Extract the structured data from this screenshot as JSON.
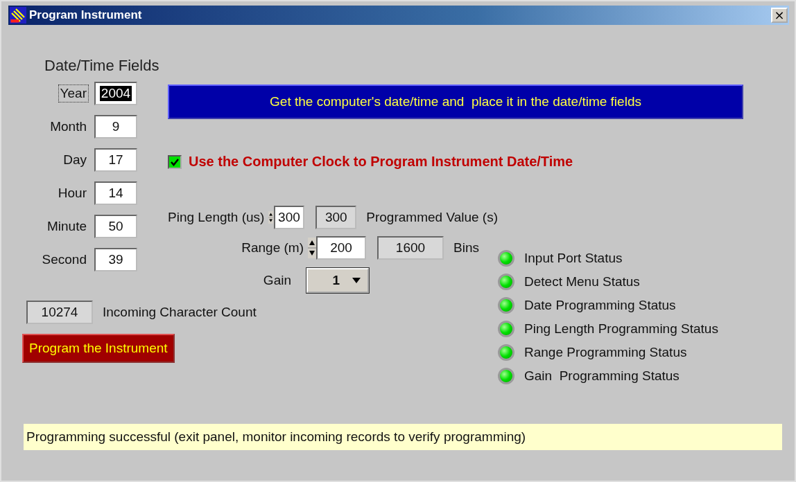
{
  "window": {
    "title": "Program Instrument",
    "close": "×"
  },
  "date_time": {
    "heading": "Date/Time Fields",
    "fields": [
      {
        "label": "Year",
        "value": "2004",
        "focused": true
      },
      {
        "label": "Month",
        "value": "9",
        "focused": false
      },
      {
        "label": "Day",
        "value": "17",
        "focused": false
      },
      {
        "label": "Hour",
        "value": "14",
        "focused": false
      },
      {
        "label": "Minute",
        "value": "50",
        "focused": false
      },
      {
        "label": "Second",
        "value": "39",
        "focused": false
      }
    ]
  },
  "get_time_button": "Get the computer's date/time and  place it in the date/time fields",
  "use_clock": {
    "label": "Use the Computer Clock to Program Instrument Date/Time",
    "checked": true
  },
  "parameters": [
    {
      "label": "Ping Length (us)",
      "value": "300",
      "readout": "300",
      "unit": "Programmed Value (s)"
    },
    {
      "label": "Range (m)",
      "value": "200",
      "readout": "1600",
      "unit": "Bins"
    }
  ],
  "gain": {
    "label": "Gain",
    "value": "1"
  },
  "char_count": {
    "value": "10274",
    "label": "Incoming Character Count"
  },
  "program_button": "Program the Instrument",
  "statuses": [
    {
      "label": "Input Port Status",
      "on": true
    },
    {
      "label": "Detect Menu Status",
      "on": true
    },
    {
      "label": "Date Programming Status",
      "on": true
    },
    {
      "label": "Ping Length Programming Status",
      "on": true
    },
    {
      "label": "Range Programming Status",
      "on": true
    },
    {
      "label": "Gain  Programming Status",
      "on": true
    }
  ],
  "message": "Programming successful (exit panel, monitor incoming records to verify programming)"
}
